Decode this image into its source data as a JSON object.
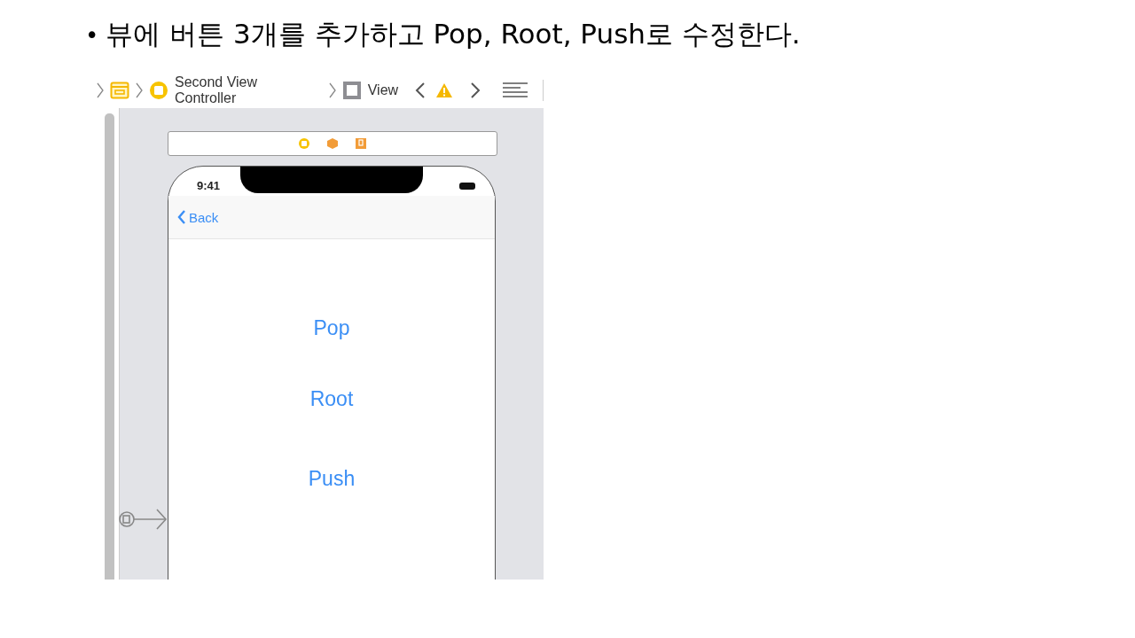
{
  "instruction": {
    "bullet": "•",
    "text": "뷰에 버튼 3개를 추가하고 Pop, Root, Push로 수정한다."
  },
  "breadcrumb": {
    "items": [
      {
        "kind": "storyboard"
      },
      {
        "kind": "controller",
        "label": "Second View Controller"
      },
      {
        "kind": "view",
        "label": "View"
      }
    ]
  },
  "phone": {
    "time": "9:41",
    "back": "Back",
    "buttons": [
      "Pop",
      "Root",
      "Push"
    ]
  }
}
